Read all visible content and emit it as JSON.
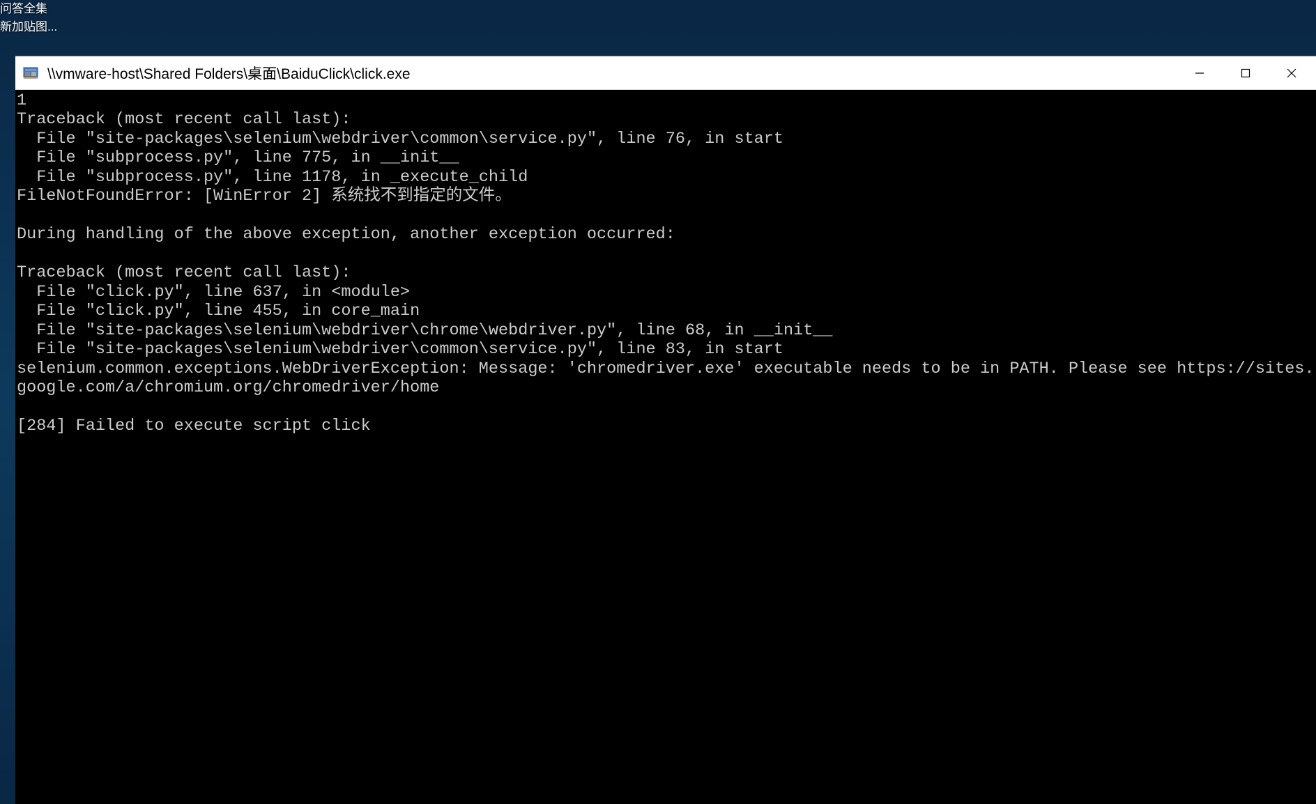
{
  "desktop": {
    "icon_labels": [
      "问答全集",
      "新加贴图..."
    ]
  },
  "window": {
    "title": "\\\\vmware-host\\Shared Folders\\桌面\\BaiduClick\\click.exe",
    "controls": {
      "minimize": "minimize",
      "maximize": "maximize",
      "close": "close"
    }
  },
  "console": {
    "lines": [
      "1",
      "Traceback (most recent call last):",
      "  File \"site-packages\\selenium\\webdriver\\common\\service.py\", line 76, in start",
      "  File \"subprocess.py\", line 775, in __init__",
      "  File \"subprocess.py\", line 1178, in _execute_child",
      "FileNotFoundError: [WinError 2] 系统找不到指定的文件。",
      "",
      "During handling of the above exception, another exception occurred:",
      "",
      "Traceback (most recent call last):",
      "  File \"click.py\", line 637, in <module>",
      "  File \"click.py\", line 455, in core_main",
      "  File \"site-packages\\selenium\\webdriver\\chrome\\webdriver.py\", line 68, in __init__",
      "  File \"site-packages\\selenium\\webdriver\\common\\service.py\", line 83, in start",
      "selenium.common.exceptions.WebDriverException: Message: 'chromedriver.exe' executable needs to be in PATH. Please see https://sites.google.com/a/chromium.org/chromedriver/home",
      "",
      "[284] Failed to execute script click"
    ]
  }
}
